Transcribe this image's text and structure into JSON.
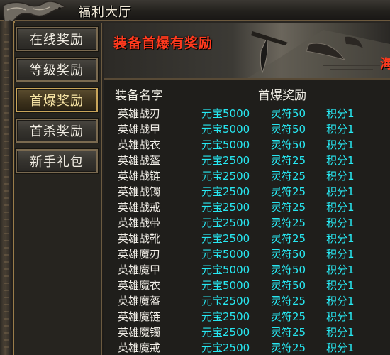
{
  "window": {
    "title": "福利大厅"
  },
  "menu": {
    "items": [
      {
        "label": "在线奖励",
        "active": false
      },
      {
        "label": "等级奖励",
        "active": false
      },
      {
        "label": "首爆奖励",
        "active": true
      },
      {
        "label": "首杀奖励",
        "active": false
      },
      {
        "label": "新手礼包",
        "active": false
      }
    ]
  },
  "banner": {
    "title": "装备首爆有奖励",
    "side_text": "海"
  },
  "table": {
    "headers": {
      "name": "装备名字",
      "reward": "首爆奖励"
    },
    "rows": [
      {
        "name": "英雄战刃",
        "yuanbao": "元宝5000",
        "lingfu": "灵符50",
        "jifen": "积分1"
      },
      {
        "name": "英雄战甲",
        "yuanbao": "元宝5000",
        "lingfu": "灵符50",
        "jifen": "积分1"
      },
      {
        "name": "英雄战衣",
        "yuanbao": "元宝5000",
        "lingfu": "灵符50",
        "jifen": "积分1"
      },
      {
        "name": "英雄战盔",
        "yuanbao": "元宝2500",
        "lingfu": "灵符25",
        "jifen": "积分1"
      },
      {
        "name": "英雄战链",
        "yuanbao": "元宝2500",
        "lingfu": "灵符25",
        "jifen": "积分1"
      },
      {
        "name": "英雄战镯",
        "yuanbao": "元宝2500",
        "lingfu": "灵符25",
        "jifen": "积分1"
      },
      {
        "name": "英雄战戒",
        "yuanbao": "元宝2500",
        "lingfu": "灵符25",
        "jifen": "积分1"
      },
      {
        "name": "英雄战带",
        "yuanbao": "元宝2500",
        "lingfu": "灵符25",
        "jifen": "积分1"
      },
      {
        "name": "英雄战靴",
        "yuanbao": "元宝2500",
        "lingfu": "灵符25",
        "jifen": "积分1"
      },
      {
        "name": "英雄魔刃",
        "yuanbao": "元宝5000",
        "lingfu": "灵符50",
        "jifen": "积分1"
      },
      {
        "name": "英雄魔甲",
        "yuanbao": "元宝5000",
        "lingfu": "灵符50",
        "jifen": "积分1"
      },
      {
        "name": "英雄魔衣",
        "yuanbao": "元宝5000",
        "lingfu": "灵符50",
        "jifen": "积分1"
      },
      {
        "name": "英雄魔盔",
        "yuanbao": "元宝2500",
        "lingfu": "灵符25",
        "jifen": "积分1"
      },
      {
        "name": "英雄魔链",
        "yuanbao": "元宝2500",
        "lingfu": "灵符25",
        "jifen": "积分1"
      },
      {
        "name": "英雄魔镯",
        "yuanbao": "元宝2500",
        "lingfu": "灵符25",
        "jifen": "积分1"
      },
      {
        "name": "英雄魔戒",
        "yuanbao": "元宝2500",
        "lingfu": "灵符25",
        "jifen": "积分1"
      }
    ]
  },
  "colors": {
    "reward_text": "#27e8f2",
    "banner_title": "#ff3a1e",
    "active_border": "#c9a55a"
  }
}
